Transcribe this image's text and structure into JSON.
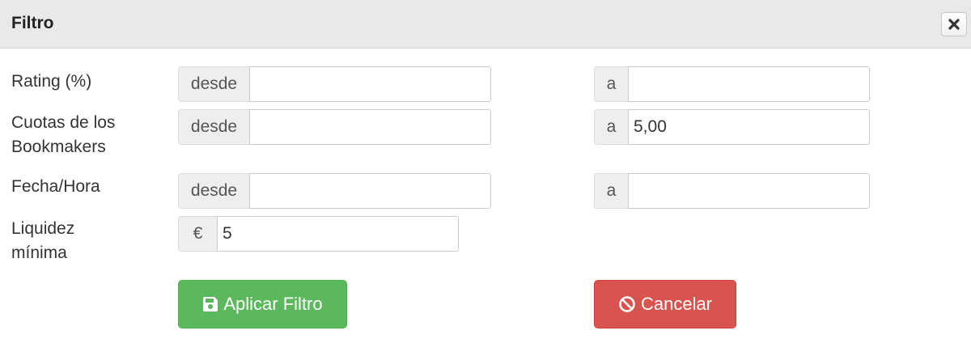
{
  "dialog": {
    "title": "Filtro",
    "close_icon": "close-icon"
  },
  "fields": {
    "rating": {
      "label": "Rating (%)",
      "from_addon": "desde",
      "from_value": "",
      "to_addon": "a",
      "to_value": ""
    },
    "odds": {
      "label_line1": "Cuotas de los",
      "label_line2": "Bookmakers",
      "from_addon": "desde",
      "from_value": "",
      "to_addon": "a",
      "to_value": "5,00"
    },
    "datetime": {
      "label": "Fecha/Hora",
      "from_addon": "desde",
      "from_value": "",
      "to_addon": "a",
      "to_value": ""
    },
    "liquidity": {
      "label_line1": "Liquidez",
      "label_line2": "mínima",
      "currency_addon": "€",
      "value": "5"
    }
  },
  "buttons": {
    "apply_label": "Aplicar Filtro",
    "apply_icon": "save-icon",
    "cancel_label": "Cancelar",
    "cancel_icon": "ban-icon"
  },
  "colors": {
    "apply": "#5cb85c",
    "cancel": "#d9534f",
    "header": "#e9e9e9"
  }
}
